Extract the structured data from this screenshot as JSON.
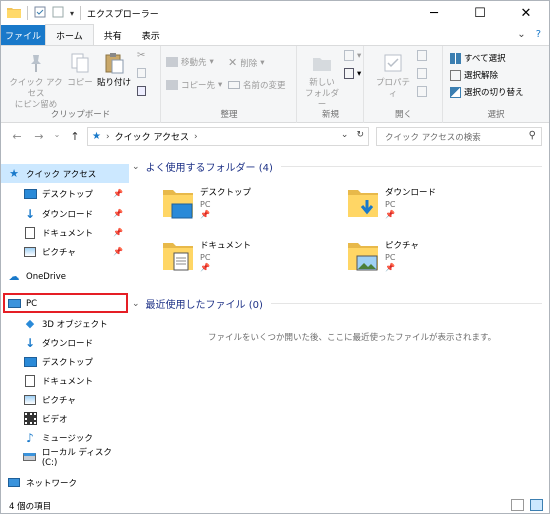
{
  "window": {
    "title": "エクスプローラー",
    "minimize_glyph": "─",
    "maximize_glyph": "☐",
    "close_glyph": "✕"
  },
  "ribbon_tabs": {
    "file": "ファイル",
    "home": "ホーム",
    "share": "共有",
    "view": "表示"
  },
  "ribbon": {
    "clipboard": {
      "label": "クリップボード",
      "pin_quick_access": "クイック アクセス\nにピン留め",
      "copy": "コピー",
      "paste": "貼り付け"
    },
    "organize": {
      "label": "整理",
      "move_to": "移動先",
      "copy_to": "コピー先",
      "delete": "削除",
      "rename": "名前の変更"
    },
    "new": {
      "label": "新規",
      "new_folder": "新しい\nフォルダー"
    },
    "open": {
      "label": "開く",
      "properties": "プロパティ"
    },
    "select": {
      "label": "選択",
      "select_all": "すべて選択",
      "select_none": "選択解除",
      "invert_selection": "選択の切り替え"
    }
  },
  "address": {
    "path": "クイック アクセス",
    "search_placeholder": "クイック アクセスの検索"
  },
  "nav": {
    "quick_access": "クイック アクセス",
    "qa_items": [
      "デスクトップ",
      "ダウンロード",
      "ドキュメント",
      "ピクチャ"
    ],
    "onedrive": "OneDrive",
    "pc": "PC",
    "pc_items": [
      "3D オブジェクト",
      "ダウンロード",
      "デスクトップ",
      "ドキュメント",
      "ピクチャ",
      "ビデオ",
      "ミュージック",
      "ローカル ディスク (C:)"
    ],
    "network": "ネットワーク"
  },
  "content": {
    "frequent_header": "よく使用するフォルダー (4)",
    "folders": [
      {
        "name": "デスクトップ",
        "location": "PC"
      },
      {
        "name": "ダウンロード",
        "location": "PC"
      },
      {
        "name": "ドキュメント",
        "location": "PC"
      },
      {
        "name": "ピクチャ",
        "location": "PC"
      }
    ],
    "recent_header": "最近使用したファイル (0)",
    "empty_message": "ファイルをいくつか開いた後、ここに最近使ったファイルが表示されます。"
  },
  "status": {
    "item_count": "4 個の項目"
  },
  "colors": {
    "file_tab": "#1979ca",
    "selection": "#cce8ff",
    "highlight_box": "#e51e25",
    "section_header": "#1e3287"
  }
}
